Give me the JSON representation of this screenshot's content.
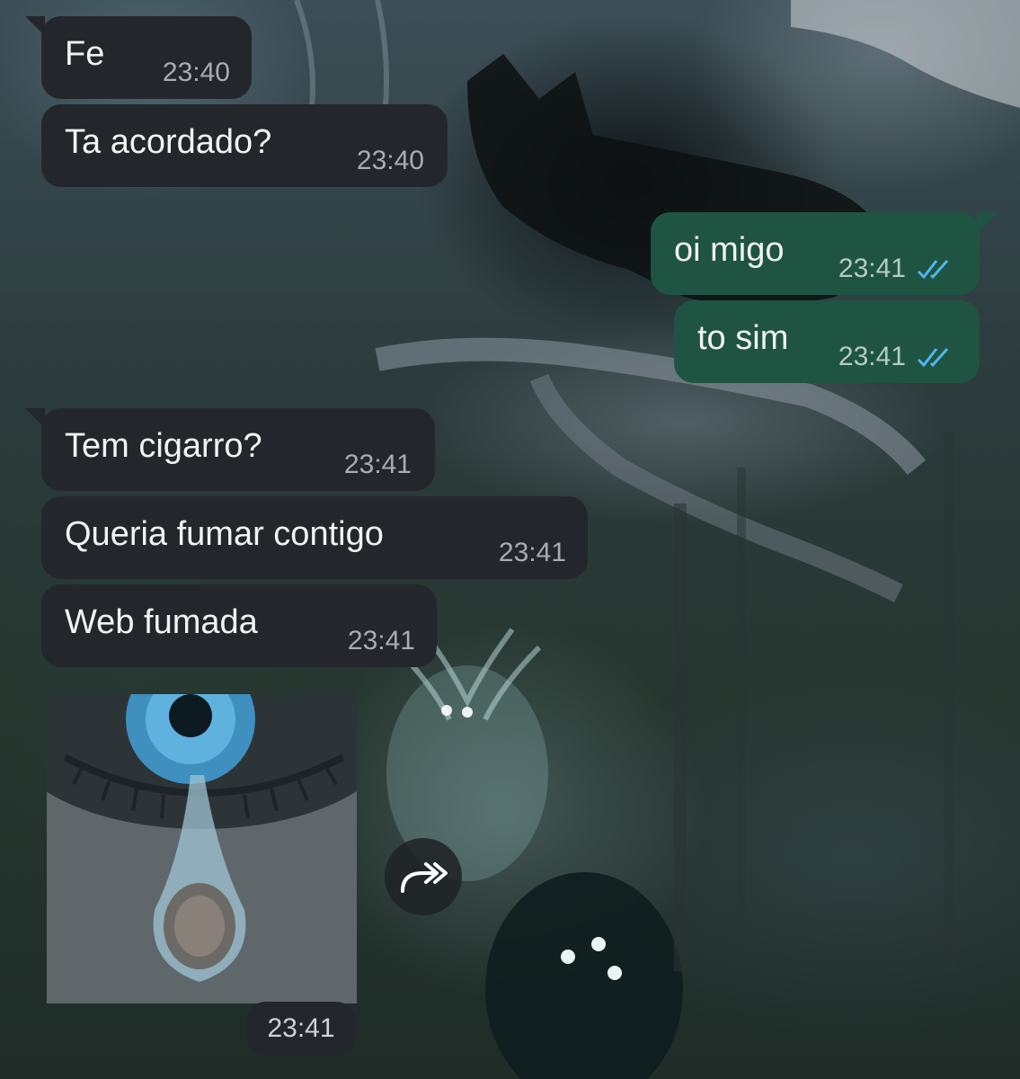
{
  "chat": {
    "messages": [
      {
        "direction": "incoming",
        "text": "Fe",
        "time": "23:40"
      },
      {
        "direction": "incoming",
        "text": "Ta acordado?",
        "time": "23:40"
      },
      {
        "direction": "outgoing",
        "text": "oi migo",
        "time": "23:41",
        "status": "read"
      },
      {
        "direction": "outgoing",
        "text": "to sim",
        "time": "23:41",
        "status": "read"
      },
      {
        "direction": "incoming",
        "text": "Tem cigarro?",
        "time": "23:41"
      },
      {
        "direction": "incoming",
        "text": "Queria fumar contigo",
        "time": "23:41"
      },
      {
        "direction": "incoming",
        "text": "Web fumada",
        "time": "23:41"
      }
    ],
    "sticker": {
      "time": "23:41",
      "icon": "forward-icon"
    }
  },
  "colors": {
    "incoming_bubble": "#23272b",
    "outgoing_bubble": "#1f5443",
    "read_tick": "#4fb6ec"
  }
}
